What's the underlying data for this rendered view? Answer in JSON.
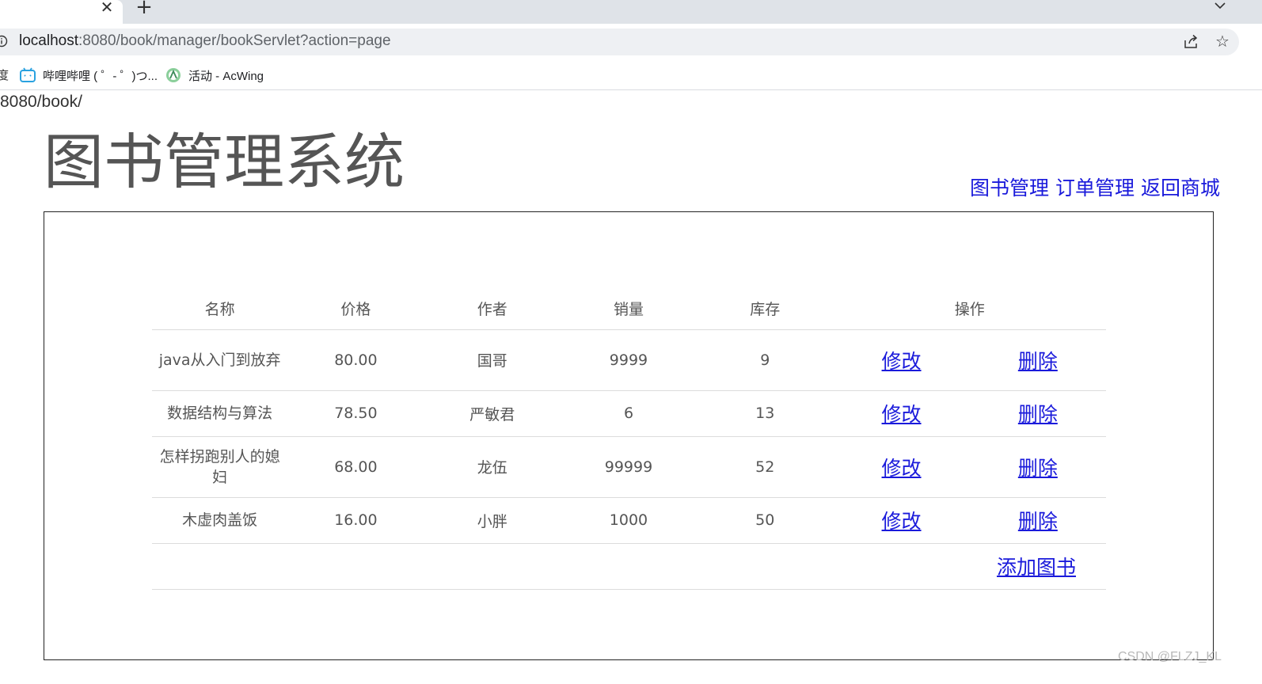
{
  "browser": {
    "url_host": "localhost",
    "url_rest": ":8080/book/manager/bookServlet?action=page",
    "bookmarks": [
      {
        "label": "哔哩哔哩 ( ゜- ゜)つ..."
      },
      {
        "label": "活动 - AcWing"
      }
    ],
    "bookmark_edge_glyph": "度"
  },
  "page": {
    "url_fragment": "8080/book/",
    "title": "图书管理系统",
    "nav": [
      {
        "label": "图书管理"
      },
      {
        "label": "订单管理"
      },
      {
        "label": "返回商城"
      }
    ],
    "table": {
      "headers": {
        "name": "名称",
        "price": "价格",
        "author": "作者",
        "sales": "销量",
        "stock": "库存",
        "op": "操作"
      },
      "rows": [
        {
          "name": "java从入门到放弃",
          "price": "80.00",
          "author": "国哥",
          "sales": "9999",
          "stock": "9",
          "edit": "修改",
          "delete": "删除"
        },
        {
          "name": "数据结构与算法",
          "price": "78.50",
          "author": "严敏君",
          "sales": "6",
          "stock": "13",
          "edit": "修改",
          "delete": "删除"
        },
        {
          "name": "怎样拐跑别人的媳妇",
          "price": "68.00",
          "author": "龙伍",
          "sales": "99999",
          "stock": "52",
          "edit": "修改",
          "delete": "删除"
        },
        {
          "name": "木虚肉盖饭",
          "price": "16.00",
          "author": "小胖",
          "sales": "1000",
          "stock": "50",
          "edit": "修改",
          "delete": "删除"
        }
      ],
      "add_label": "添加图书"
    }
  },
  "watermark": "CSDN @FLZJ_KL",
  "colors": {
    "link": "#1a1adb",
    "text": "#555555",
    "tabstrip": "#dfe3e8",
    "omnibox": "#eef0f3"
  }
}
